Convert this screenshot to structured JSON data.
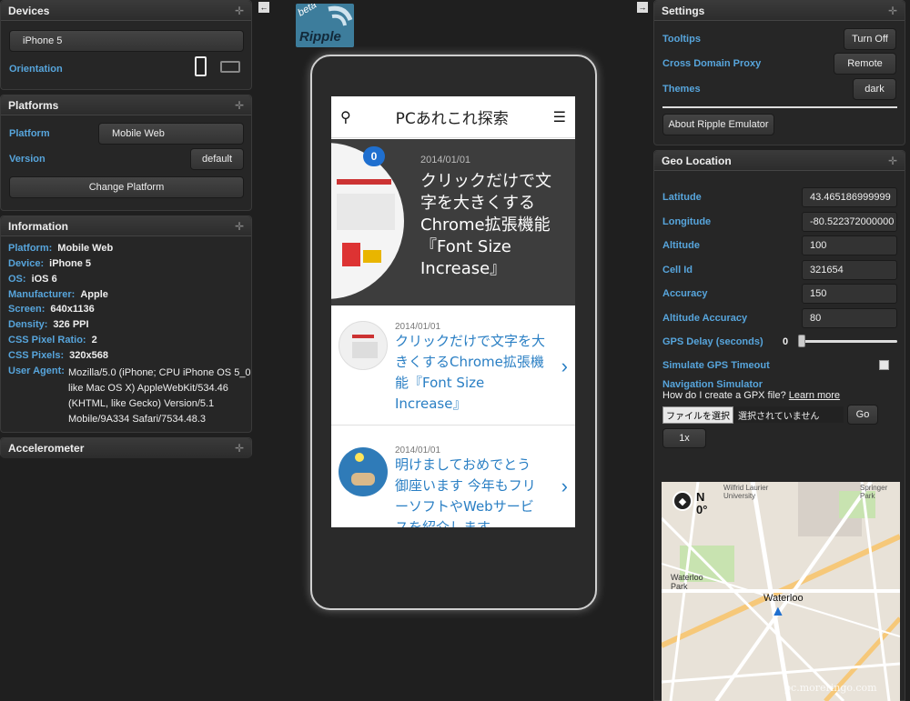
{
  "devices": {
    "title": "Devices",
    "device_value": "iPhone 5",
    "orientation_label": "Orientation"
  },
  "platforms": {
    "title": "Platforms",
    "platform_label": "Platform",
    "platform_value": "Mobile Web",
    "version_label": "Version",
    "version_value": "default",
    "change_button": "Change Platform"
  },
  "information": {
    "title": "Information",
    "rows": [
      {
        "k": "Platform:",
        "v": "Mobile Web"
      },
      {
        "k": "Device:",
        "v": "iPhone 5"
      },
      {
        "k": "OS:",
        "v": "iOS 6"
      },
      {
        "k": "Manufacturer:",
        "v": "Apple"
      },
      {
        "k": "Screen:",
        "v": "640x1136"
      },
      {
        "k": "Density:",
        "v": "326 PPI"
      },
      {
        "k": "CSS Pixel Ratio:",
        "v": "2"
      },
      {
        "k": "CSS Pixels:",
        "v": "320x568"
      }
    ],
    "user_agent_label": "User Agent:",
    "user_agent_lines": [
      "Mozilla/5.0 (iPhone; CPU iPhone OS 5_0",
      "like Mac OS X) AppleWebKit/534.46",
      "(KHTML, like Gecko) Version/5.1",
      "Mobile/9A334 Safari/7534.48.3"
    ]
  },
  "accelerometer": {
    "title": "Accelerometer"
  },
  "logo": {
    "beta": "beta",
    "name": "Ripple"
  },
  "phone_screen": {
    "app_title": "PCあれこれ探索",
    "hero": {
      "badge": "0",
      "date": "2014/01/01",
      "lines": [
        "クリックだけで文",
        "字を大きくする",
        "Chrome拡張機能",
        "『Font Size",
        "Increase』"
      ]
    },
    "articles": [
      {
        "date": "2014/01/01",
        "lines": [
          "クリックだけで文字を大",
          "きくするChrome拡張機",
          "能『Font Size",
          "Increase』"
        ]
      },
      {
        "date": "2014/01/01",
        "lines": [
          "明けましておめでとう",
          "御座います 今年もフリ",
          "ーソフトやWebサービ",
          "スを紹介します"
        ]
      }
    ]
  },
  "settings": {
    "title": "Settings",
    "tooltips_label": "Tooltips",
    "tooltips_value": "Turn Off",
    "proxy_label": "Cross Domain Proxy",
    "proxy_value": "Remote",
    "themes_label": "Themes",
    "themes_value": "dark",
    "about_button": "About Ripple Emulator"
  },
  "geo": {
    "title": "Geo Location",
    "fields": [
      {
        "label": "Latitude",
        "value": "43.465186999999"
      },
      {
        "label": "Longitude",
        "value": "-80.522372000000"
      },
      {
        "label": "Altitude",
        "value": "100"
      },
      {
        "label": "Cell Id",
        "value": "321654"
      },
      {
        "label": "Accuracy",
        "value": "150"
      },
      {
        "label": "Altitude Accuracy",
        "value": "80"
      }
    ],
    "gps_delay_label": "GPS Delay (seconds)",
    "gps_delay_value": "0",
    "timeout_label": "Simulate GPS Timeout",
    "nav_label": "Navigation Simulator",
    "gpx_question": "How do I create a GPX file?",
    "learn_more": "Learn more",
    "file_button": "ファイルを選択",
    "file_status": "選択されていません",
    "go_button": "Go",
    "speed_button": "1x",
    "compass_dir": "N",
    "compass_deg": "0°",
    "map_label": "Waterloo",
    "map_labels": [
      "Waterloo Park",
      "Wilfrid Laurier University",
      "Springer Park"
    ],
    "watermark": "pc.moreringo.com"
  }
}
